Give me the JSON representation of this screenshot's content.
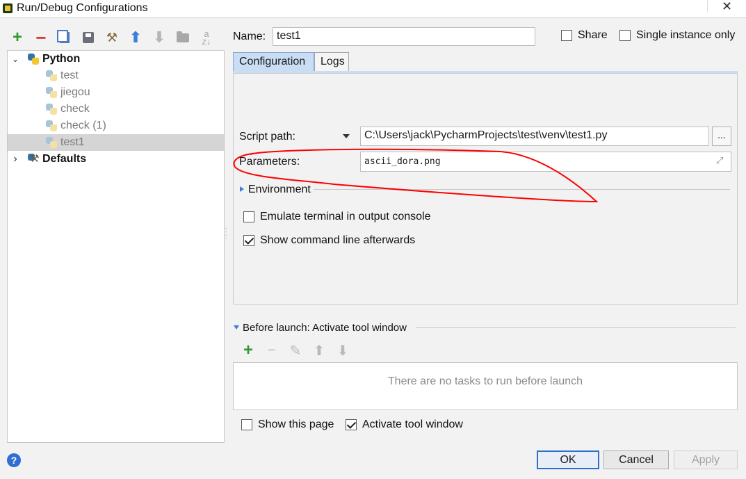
{
  "window": {
    "title": "Run/Debug Configurations",
    "close_glyph": "✕"
  },
  "toolbar": {
    "add": "+",
    "remove": "−",
    "up": "⬆",
    "down": "⬇",
    "icons": [
      "add-icon",
      "remove-icon",
      "copy-icon",
      "save-icon",
      "edit-defaults-icon",
      "move-up-icon",
      "move-down-icon",
      "folder-icon",
      "sort-icon"
    ]
  },
  "tree": {
    "group": {
      "label": "Python",
      "expanded": true,
      "arrow": "⌄"
    },
    "items": [
      {
        "label": "test"
      },
      {
        "label": "jiegou"
      },
      {
        "label": "check"
      },
      {
        "label": "check (1)"
      },
      {
        "label": "test1",
        "selected": true
      }
    ],
    "defaults": {
      "label": "Defaults",
      "arrow": "›"
    }
  },
  "header": {
    "name_label": "Name:",
    "name_value": "test1",
    "share_label": "Share",
    "share_checked": false,
    "single_instance_label": "Single instance only",
    "single_instance_checked": false
  },
  "tabs": [
    {
      "label": "Configuration",
      "active": true
    },
    {
      "label": "Logs",
      "active": false
    }
  ],
  "config": {
    "script_path_label": "Script path:",
    "script_path_value": "C:\\Users\\jack\\PycharmProjects\\test\\venv\\test1.py",
    "browse_label": "...",
    "parameters_label": "Parameters:",
    "parameters_value": "ascii_dora.png",
    "expand_glyph": "⤢",
    "environment_label": "Environment",
    "emulate_terminal_label": "Emulate terminal in output console",
    "emulate_terminal_checked": false,
    "show_cmdline_label": "Show command line afterwards",
    "show_cmdline_checked": true
  },
  "before_launch": {
    "title": "Before launch: Activate tool window",
    "add": "+",
    "remove": "−",
    "edit": "✎",
    "up": "⬆",
    "down": "⬇",
    "empty_text": "There are no tasks to run before launch"
  },
  "footer": {
    "show_page_label": "Show this page",
    "show_page_checked": false,
    "activate_tool_label": "Activate tool window",
    "activate_tool_checked": true,
    "ok_label": "OK",
    "cancel_label": "Cancel",
    "apply_label": "Apply",
    "help_label": "?"
  },
  "colors": {
    "accent": "#2d6fc9",
    "selection": "#d5d5d5",
    "active_tab": "#c9ddf4",
    "annotation": "#ff0000"
  }
}
